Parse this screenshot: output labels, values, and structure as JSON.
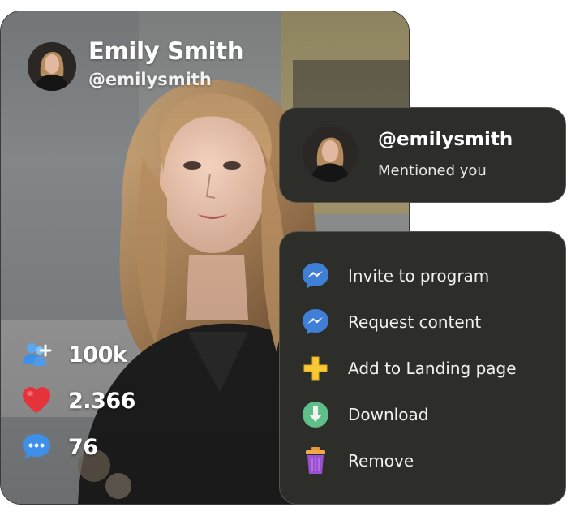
{
  "profile": {
    "name": "Emily Smith",
    "handle": "@emilysmith",
    "stats": [
      {
        "icon": "add-user-icon",
        "value": "100k"
      },
      {
        "icon": "heart-icon",
        "value": "2.366"
      },
      {
        "icon": "chat-bubble-icon",
        "value": "76"
      }
    ]
  },
  "notification": {
    "handle": "@emilysmith",
    "text": "Mentioned you"
  },
  "menu": {
    "items": [
      {
        "icon": "messenger-icon",
        "label": "Invite to program"
      },
      {
        "icon": "messenger-icon",
        "label": "Request content"
      },
      {
        "icon": "plus-icon",
        "label": "Add to Landing page"
      },
      {
        "icon": "download-icon",
        "label": "Download"
      },
      {
        "icon": "trash-can-icon",
        "label": "Remove"
      }
    ]
  },
  "colors": {
    "panel_bg": "#2d2d2a",
    "panel_border": "#55564f",
    "text_light": "#f1f1ee",
    "messenger_blue": "#3f7fd6",
    "plus_yellow": "#f7c935",
    "download_green": "#5fbf88",
    "trash_purple": "#9a4fd0",
    "heart_red": "#e5323b"
  }
}
